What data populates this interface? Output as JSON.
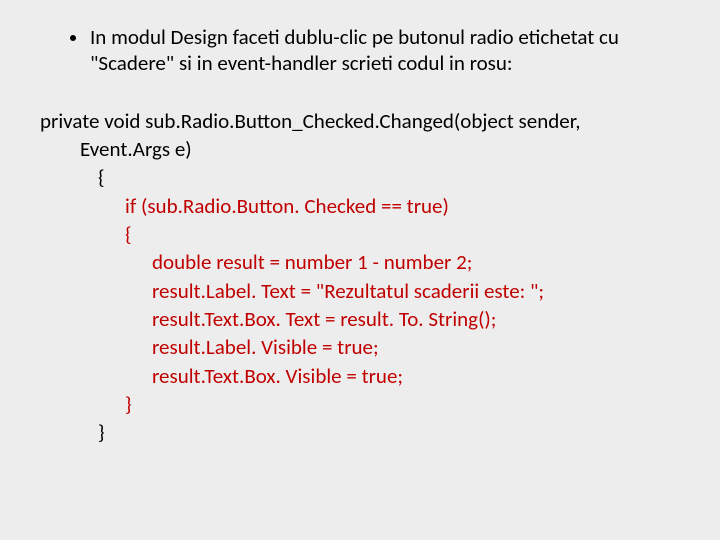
{
  "bullet": {
    "text": "In modul Design faceti dublu-clic pe butonul radio etichetat cu \"Scadere\" si in event-handler scrieti codul in rosu:"
  },
  "code": {
    "sig1": "private void sub.Radio.Button_Checked.Changed(object sender,",
    "sig2": "Event.Args e)",
    "brace_open": "{",
    "if_line": "if (sub.Radio.Button. Checked == true)",
    "if_brace_open": "{",
    "line1": "double result = number 1 - number 2;",
    "line2": "result.Label. Text = \"Rezultatul scaderii este: \";",
    "line3": "result.Text.Box. Text = result. To. String();",
    "line4": "result.Label. Visible = true;",
    "line5": "result.Text.Box. Visible = true;",
    "if_brace_close": "}",
    "brace_close": "}"
  }
}
